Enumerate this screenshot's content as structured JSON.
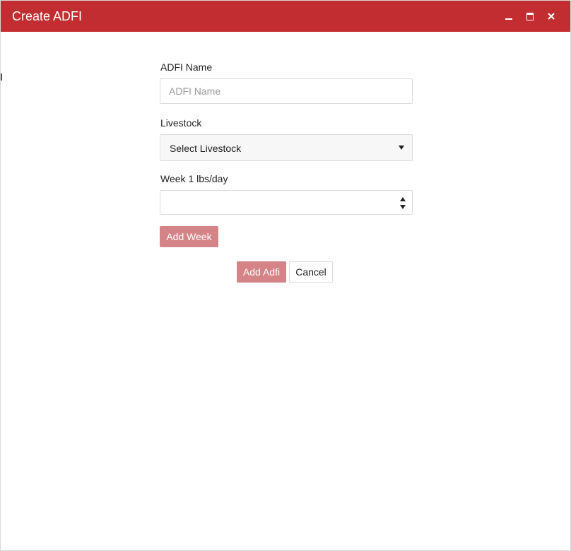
{
  "window": {
    "title": "Create ADFI",
    "controls": [
      "minimize-icon",
      "maximize-icon",
      "close-icon"
    ],
    "accent_color": "#c12d30"
  },
  "form": {
    "name_label": "ADFI Name",
    "name_placeholder": "ADFI Name",
    "livestock_label": "Livestock",
    "livestock_selected": "Select Livestock",
    "week_label": "Week 1 lbs/day",
    "week_value": "",
    "add_week_label": "Add Week"
  },
  "footer": {
    "add_label": "Add Adfi",
    "cancel_label": "Cancel",
    "button_color": "#d48386"
  }
}
